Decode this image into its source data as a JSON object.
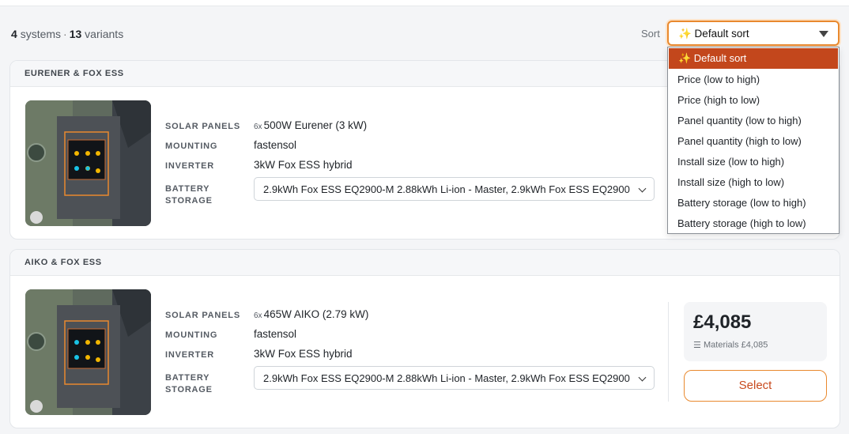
{
  "summary": {
    "systems_count": "4",
    "systems_label": "systems",
    "separator": "·",
    "variants_count": "13",
    "variants_label": "variants"
  },
  "sort": {
    "label": "Sort",
    "selected": "✨ Default sort",
    "options": [
      "✨ Default sort",
      "Price (low to high)",
      "Price (high to low)",
      "Panel quantity (low to high)",
      "Panel quantity (high to low)",
      "Install size (low to high)",
      "Install size (high to low)",
      "Battery storage (low to high)",
      "Battery storage (high to low)"
    ]
  },
  "spec_labels": {
    "panels": "SOLAR PANELS",
    "mounting": "MOUNTING",
    "inverter": "INVERTER",
    "battery_line1": "BATTERY",
    "battery_line2": "STORAGE"
  },
  "systems": [
    {
      "title": "EURENER & FOX ESS",
      "panel_qty": "6x",
      "panel_desc": "500W Eurener (3 kW)",
      "mounting": "fastensol",
      "inverter": "3kW Fox ESS hybrid",
      "battery": "2.9kWh Fox ESS EQ2900-M 2.88kWh Li-ion - Master, 2.9kWh Fox ESS EQ2900"
    },
    {
      "title": "AIKO & FOX ESS",
      "panel_qty": "6x",
      "panel_desc": "465W AIKO (2.79 kW)",
      "mounting": "fastensol",
      "inverter": "3kW Fox ESS hybrid",
      "battery": "2.9kWh Fox ESS EQ2900-M 2.88kWh Li-ion - Master, 2.9kWh Fox ESS EQ2900",
      "price": "£4,085",
      "materials": "Materials £4,085",
      "select_label": "Select"
    }
  ],
  "colors": {
    "accent": "#e9892e",
    "selected_option": "#c3471c",
    "select_text": "#c84a1e"
  }
}
